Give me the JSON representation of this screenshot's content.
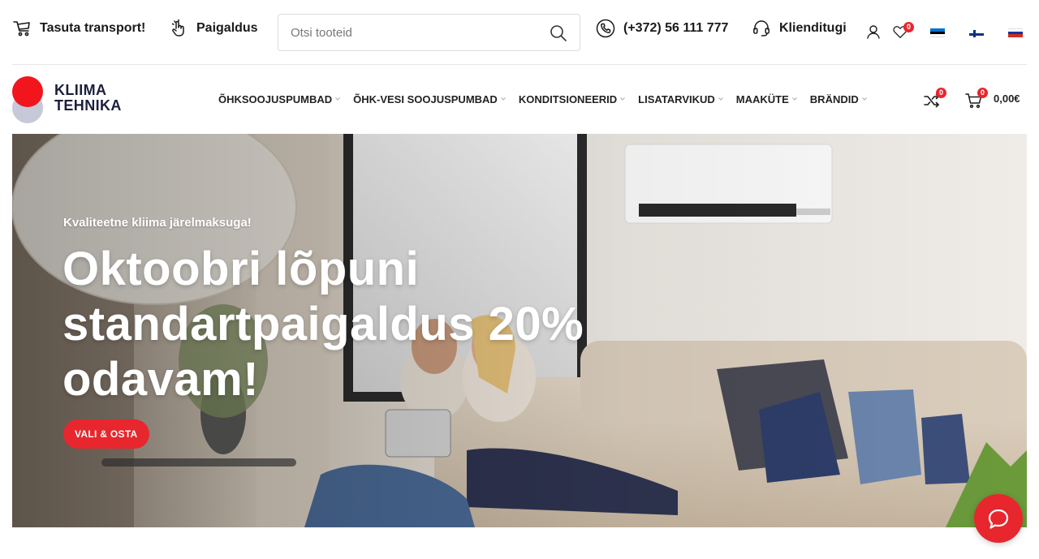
{
  "topbar": {
    "transport_label": "Tasuta transport!",
    "install_label": "Paigaldus",
    "search_placeholder": "Otsi tooteid",
    "phone_label": "(+372) 56 111 777",
    "support_label": "Klienditugi",
    "wishlist_count": "0",
    "languages": [
      "et",
      "fi",
      "ru"
    ]
  },
  "logo": {
    "line1": "KLIIMA",
    "line2": "TEHNIKA"
  },
  "nav": {
    "items": [
      {
        "label": "ÕHKSOOJUSPUMBAD"
      },
      {
        "label": "ÕHK-VESI SOOJUSPUMBAD"
      },
      {
        "label": "KONDITSIONEERID"
      },
      {
        "label": "LISATARVIKUD"
      },
      {
        "label": "MAAKÜTE"
      },
      {
        "label": "BRÄNDID"
      }
    ]
  },
  "header_tools": {
    "compare_count": "0",
    "cart_count": "0",
    "cart_total": "0,00€"
  },
  "hero": {
    "subtitle": "Kvaliteetne kliima järelmaksuga!",
    "title_line1": "Oktoobri lõpuni",
    "title_line2": "standartpaigaldus 20%",
    "title_line3": "odavam!",
    "button_label": "VALI & OSTA"
  },
  "colors": {
    "accent": "#e8262d",
    "logo_red": "#f2151c",
    "logo_grey": "#c7c9d9",
    "logo_text": "#1b1f3b"
  },
  "icons": {
    "transport": "truck-icon",
    "install": "hand-tap-icon",
    "search": "search-icon",
    "phone": "phone-icon",
    "support": "headset-icon",
    "account": "user-icon",
    "wishlist": "heart-icon",
    "compare": "shuffle-icon",
    "cart": "cart-icon",
    "chat": "chat-bubble-icon"
  }
}
